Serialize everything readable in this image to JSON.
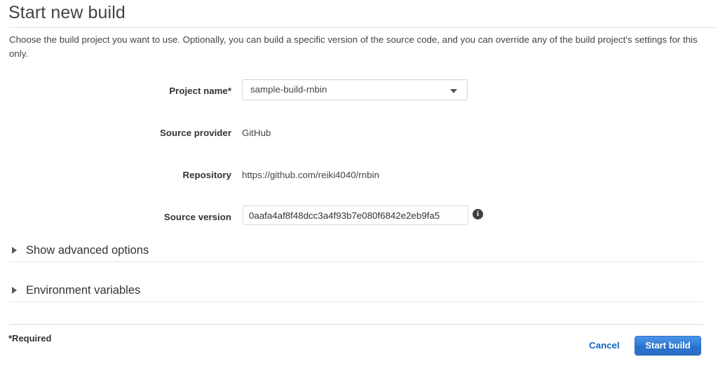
{
  "header": {
    "title": "Start new build",
    "description": "Choose the build project you want to use. Optionally, you can build a specific version of the source code, and you can override any of the build project's settings for this\nonly."
  },
  "form": {
    "project_name": {
      "label": "Project name*",
      "value": "sample-build-rnbin",
      "caret_icon": "chevron-down-icon"
    },
    "source_provider": {
      "label": "Source provider",
      "value": "GitHub"
    },
    "repository": {
      "label": "Repository",
      "value": "https://github.com/reiki4040/rnbin"
    },
    "source_version": {
      "label": "Source version",
      "value": "0aafa4af8f48dcc3a4f93b7e080f6842e2eb9fa5",
      "placeholder": "",
      "info_icon": "info-icon",
      "info_glyph": "i"
    }
  },
  "sections": [
    {
      "label": "Show advanced options",
      "toggle_icon": "triangle-right-icon",
      "expanded": false
    },
    {
      "label": "Environment variables",
      "toggle_icon": "triangle-right-icon",
      "expanded": false
    }
  ],
  "footer": {
    "required_note": "*Required",
    "cancel_label": "Cancel",
    "submit_label": "Start build"
  },
  "colors": {
    "primary_button": "#2f7bd4",
    "link": "#1166bb",
    "text": "#333333",
    "rule": "#e4e4e4"
  }
}
